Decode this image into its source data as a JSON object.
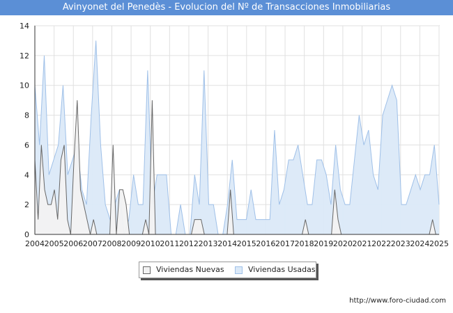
{
  "title": "Avinyonet del Penedès - Evolucion del Nº de Transacciones Inmobiliarias",
  "source": "http://www.foro-ciudad.com",
  "chart_data": {
    "type": "area",
    "title": "Avinyonet del Penedès - Evolucion del Nº de Transacciones Inmobiliarias",
    "xlabel": "",
    "ylabel": "",
    "ylim": [
      0,
      14
    ],
    "yticks": [
      0,
      2,
      4,
      6,
      8,
      10,
      12,
      14
    ],
    "x_labels": [
      "2004",
      "2005",
      "2006",
      "2007",
      "2008",
      "2009",
      "2010",
      "2011",
      "2012",
      "2013",
      "2014",
      "2015",
      "2016",
      "2017",
      "2018",
      "2019",
      "2020",
      "2021",
      "2022",
      "2023",
      "2024",
      "2025"
    ],
    "x_granularity": "quarterly, 2004 Q1 – 2025 Q1",
    "grid": true,
    "legend_position": "bottom",
    "series": [
      {
        "name": "Viviendas Nuevas",
        "color": "#f2f2f2",
        "line_color": "#666666",
        "values": [
          5,
          1,
          6,
          3,
          2,
          2,
          3,
          1,
          5,
          6,
          1,
          0,
          5,
          9,
          3,
          2,
          1,
          0,
          1,
          0,
          0,
          0,
          0,
          0,
          6,
          0,
          3,
          3,
          2,
          0,
          0,
          0,
          0,
          0,
          1,
          0,
          9,
          0,
          0,
          0,
          0,
          0,
          0,
          0,
          0,
          0,
          0,
          0,
          0,
          1,
          1,
          1,
          0,
          0,
          0,
          0,
          0,
          0,
          0,
          0,
          3,
          0,
          0,
          0,
          0,
          0,
          0,
          0,
          0,
          0,
          0,
          0,
          0,
          0,
          0,
          0,
          0,
          0,
          0,
          0,
          0,
          0,
          0,
          1,
          0,
          0,
          0,
          0,
          0,
          0,
          0,
          0,
          3,
          1,
          0,
          0,
          0,
          0,
          0,
          0,
          0,
          0,
          0,
          0,
          0,
          0,
          0,
          0,
          0,
          0,
          0,
          0,
          0,
          0,
          0,
          0,
          0,
          0,
          0,
          0,
          0,
          0,
          1,
          0,
          0
        ]
      },
      {
        "name": "Viviendas Usadas",
        "color": "#dbe9f8",
        "line_color": "#9fc0e8",
        "values": [
          10,
          6,
          12,
          4,
          5,
          6,
          10,
          4,
          5,
          6,
          3,
          2,
          8,
          13,
          6,
          2,
          1,
          2,
          3,
          0,
          1,
          4,
          2,
          2,
          11,
          2,
          4,
          4,
          4,
          0,
          0,
          2,
          0,
          0,
          4,
          2,
          11,
          2,
          2,
          0,
          0,
          2,
          5,
          1,
          1,
          1,
          3,
          1,
          1,
          1,
          1,
          7,
          2,
          3,
          5,
          5,
          6,
          4,
          2,
          2,
          5,
          5,
          4,
          2,
          6,
          3,
          2,
          2,
          5,
          8,
          6,
          7,
          4,
          3,
          8,
          9,
          10,
          9,
          2,
          2,
          3,
          4,
          3,
          4,
          4,
          6,
          2
        ]
      }
    ]
  }
}
